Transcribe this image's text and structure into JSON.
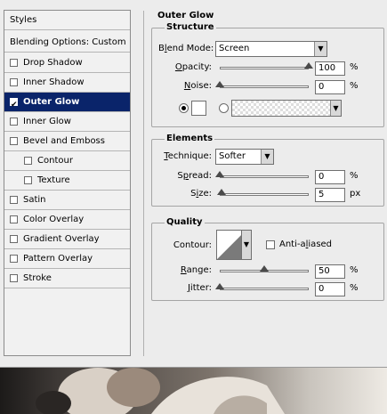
{
  "styles_list": {
    "header": "Styles",
    "blending_options": "Blending Options: Custom",
    "items": [
      {
        "label": "Drop Shadow",
        "checked": false,
        "indent": false,
        "selected": false
      },
      {
        "label": "Inner Shadow",
        "checked": false,
        "indent": false,
        "selected": false
      },
      {
        "label": "Outer Glow",
        "checked": true,
        "indent": false,
        "selected": true
      },
      {
        "label": "Inner Glow",
        "checked": false,
        "indent": false,
        "selected": false
      },
      {
        "label": "Bevel and Emboss",
        "checked": false,
        "indent": false,
        "selected": false
      },
      {
        "label": "Contour",
        "checked": false,
        "indent": true,
        "selected": false
      },
      {
        "label": "Texture",
        "checked": false,
        "indent": true,
        "selected": false
      },
      {
        "label": "Satin",
        "checked": false,
        "indent": false,
        "selected": false
      },
      {
        "label": "Color Overlay",
        "checked": false,
        "indent": false,
        "selected": false
      },
      {
        "label": "Gradient Overlay",
        "checked": false,
        "indent": false,
        "selected": false
      },
      {
        "label": "Pattern Overlay",
        "checked": false,
        "indent": false,
        "selected": false
      },
      {
        "label": "Stroke",
        "checked": false,
        "indent": false,
        "selected": false
      }
    ]
  },
  "outer_glow": {
    "title": "Outer Glow",
    "structure": {
      "title": "Structure",
      "blend_mode_label_pre": "B",
      "blend_mode_label_ul": "l",
      "blend_mode_label_post": "end Mode:",
      "blend_mode_value": "Screen",
      "opacity_label_ul": "O",
      "opacity_label_post": "pacity:",
      "opacity_value": "100",
      "opacity_level": 1.0,
      "opacity_unit": "%",
      "noise_label_ul": "N",
      "noise_label_post": "oise:",
      "noise_value": "0",
      "noise_level": 0.0,
      "noise_unit": "%",
      "color_mode": "solid",
      "swatch_color": "#ffffff"
    },
    "elements": {
      "title": "Elements",
      "technique_label_ul": "T",
      "technique_label_post": "echnique:",
      "technique_value": "Softer",
      "spread_label_pre": "S",
      "spread_label_ul": "p",
      "spread_label_post": "read:",
      "spread_value": "0",
      "spread_level": 0.0,
      "spread_unit": "%",
      "size_label_pre": "S",
      "size_label_ul": "i",
      "size_label_post": "ze:",
      "size_value": "5",
      "size_level": 0.02,
      "size_unit": "px"
    },
    "quality": {
      "title": "Quality",
      "contour_label": "Contour:",
      "anti_aliased_label_pre": "Anti-a",
      "anti_aliased_label_ul": "l",
      "anti_aliased_label_post": "iased",
      "anti_aliased_checked": false,
      "range_label_ul": "R",
      "range_label_post": "ange:",
      "range_value": "50",
      "range_level": 0.5,
      "range_unit": "%",
      "jitter_label_ul": "J",
      "jitter_label_post": "itter:",
      "jitter_value": "0",
      "jitter_level": 0.0,
      "jitter_unit": "%"
    }
  },
  "colors": {
    "selected_bg": "#0a246a",
    "dialog_bg": "#ececec"
  }
}
